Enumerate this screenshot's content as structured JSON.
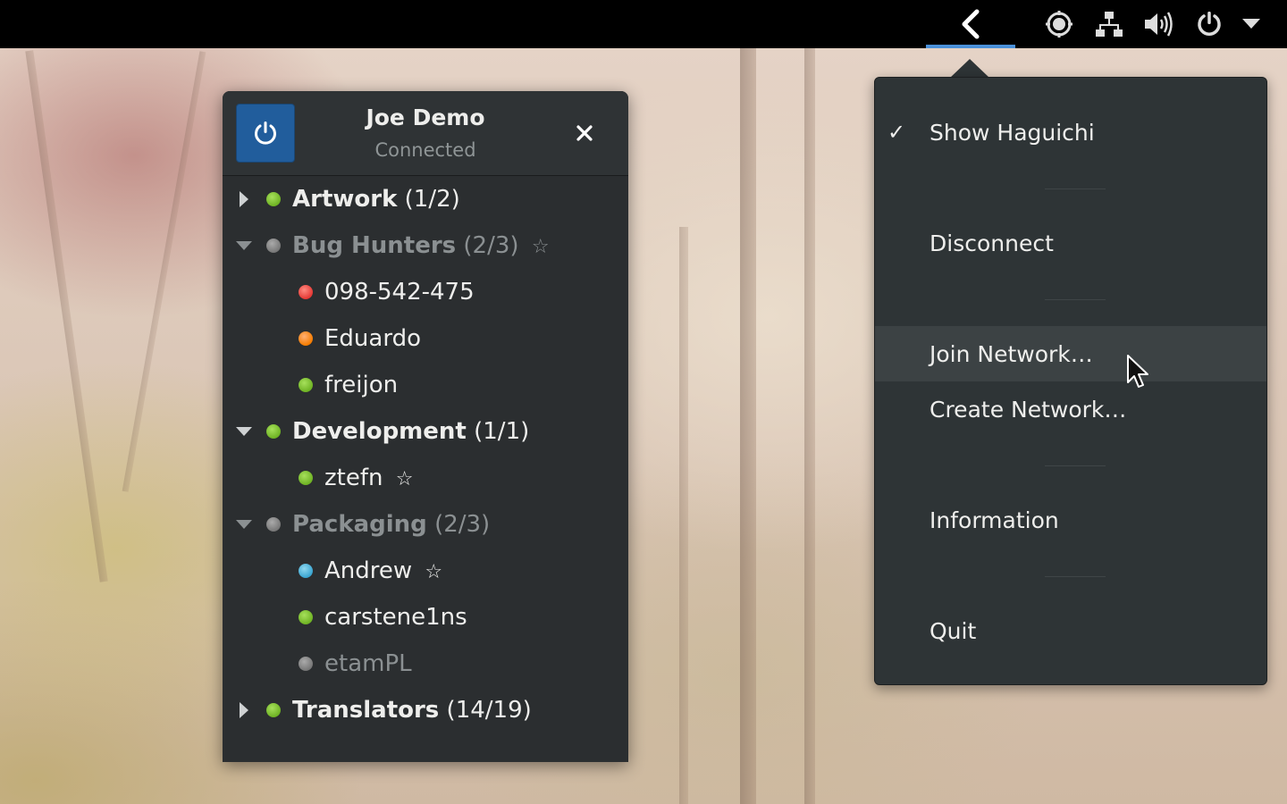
{
  "topbar": {
    "icons": [
      "back-chevron-icon",
      "haguichi-icon",
      "network-icon",
      "volume-icon",
      "power-icon",
      "dropdown-arrow-icon"
    ]
  },
  "window": {
    "title": "Joe Demo",
    "subtitle": "Connected",
    "groups": [
      {
        "name": "Artwork",
        "count": "(1/2)",
        "status": "online",
        "expanded": false,
        "starred": false,
        "members": []
      },
      {
        "name": "Bug Hunters",
        "count": "(2/3)",
        "status": "offline",
        "expanded": true,
        "starred": true,
        "members": [
          {
            "name": "098-542-475",
            "status": "unreachable",
            "starred": false
          },
          {
            "name": "Eduardo",
            "status": "relayed",
            "starred": false
          },
          {
            "name": "freijon",
            "status": "online",
            "starred": false
          }
        ]
      },
      {
        "name": "Development",
        "count": "(1/1)",
        "status": "online",
        "expanded": true,
        "starred": false,
        "members": [
          {
            "name": "ztefn",
            "status": "online",
            "starred": true
          }
        ]
      },
      {
        "name": "Packaging",
        "count": "(2/3)",
        "status": "offline",
        "expanded": true,
        "starred": false,
        "members": [
          {
            "name": "Andrew",
            "status": "away",
            "starred": true
          },
          {
            "name": "carstene1ns",
            "status": "online",
            "starred": false
          },
          {
            "name": "etamPL",
            "status": "offline",
            "starred": false
          }
        ]
      },
      {
        "name": "Translators",
        "count": "(14/19)",
        "status": "online",
        "expanded": false,
        "starred": false,
        "members": []
      }
    ]
  },
  "menu": {
    "show_haguichi": "Show Haguichi",
    "show_haguichi_checked": true,
    "check_mark": "✓",
    "disconnect": "Disconnect",
    "join_network": "Join Network…",
    "create_network": "Create Network…",
    "information": "Information",
    "quit": "Quit"
  },
  "colors": {
    "accent": "#4a90d9",
    "power_button": "#215d9c",
    "status_online": "#73c02a",
    "status_unreachable": "#e53935",
    "status_relayed": "#f57c00",
    "status_away": "#3aa5d0",
    "status_offline": "#8b8b8b"
  }
}
